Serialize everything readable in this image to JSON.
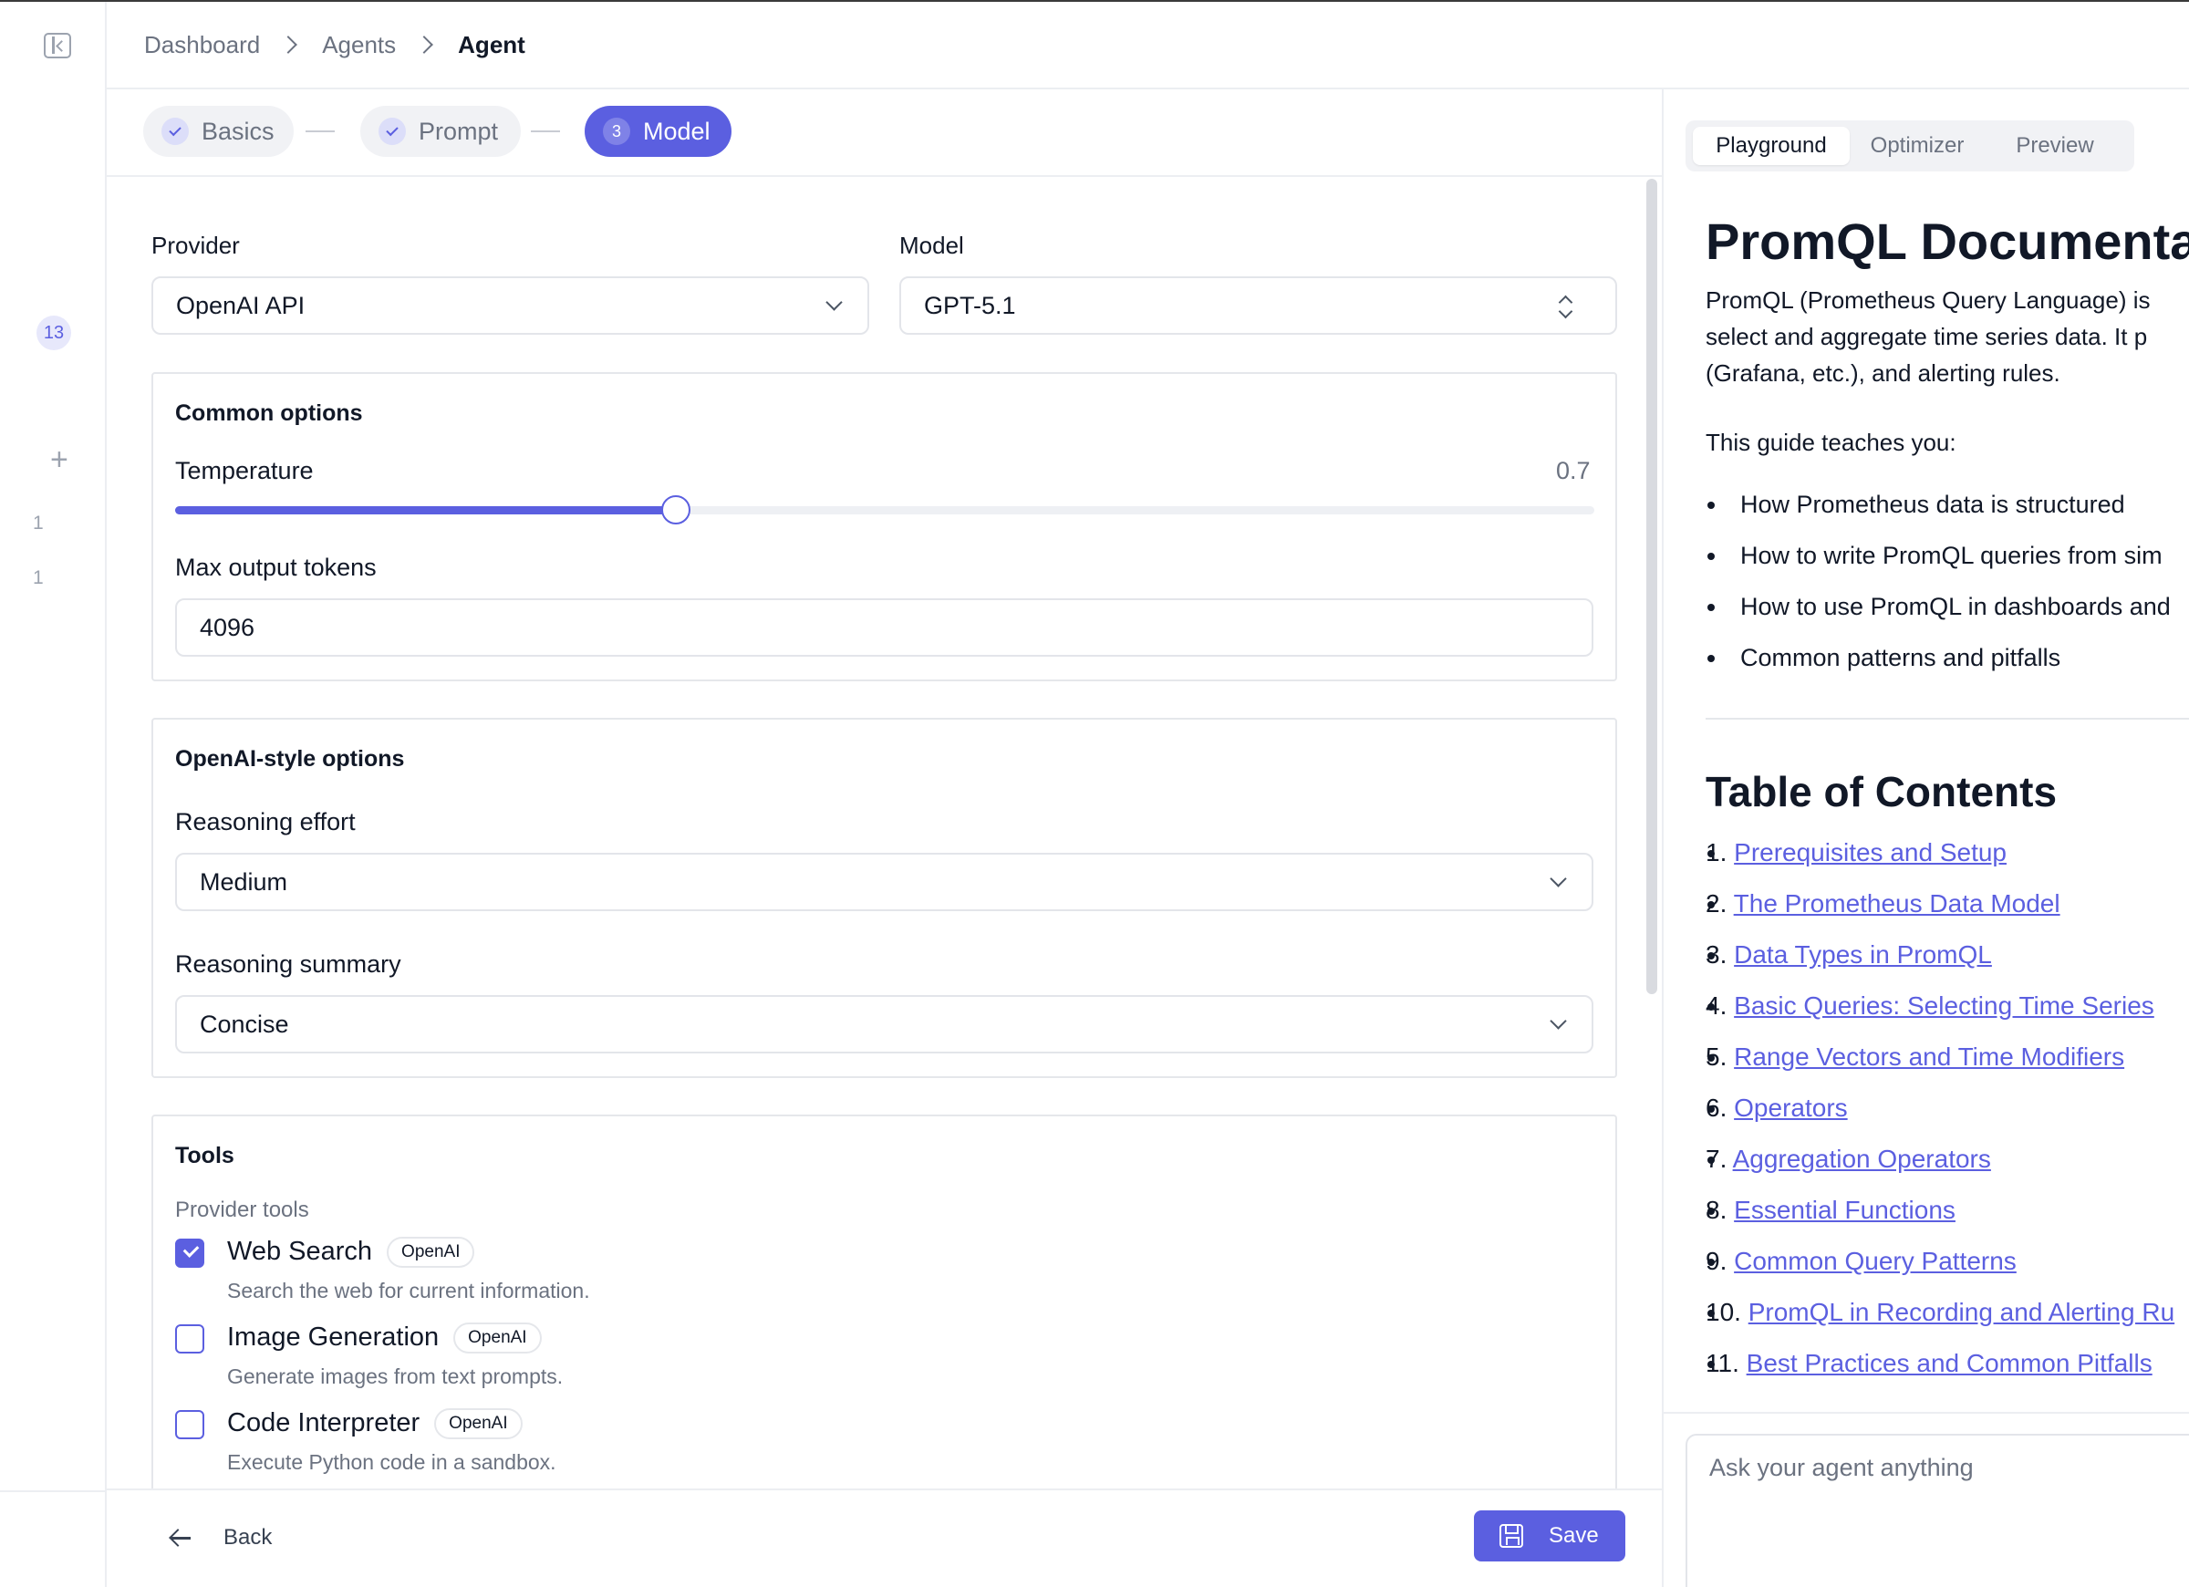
{
  "breadcrumb": {
    "items": [
      "Dashboard",
      "Agents",
      "Agent"
    ]
  },
  "rail": {
    "badge": "13",
    "counts": [
      "1",
      "1"
    ]
  },
  "stepper": {
    "steps": [
      {
        "label": "Basics",
        "state": "done"
      },
      {
        "label": "Prompt",
        "state": "done"
      },
      {
        "label": "Model",
        "state": "current",
        "number": "3"
      }
    ]
  },
  "form": {
    "provider": {
      "label": "Provider",
      "value": "OpenAI API"
    },
    "model": {
      "label": "Model",
      "value": "GPT-5.1"
    },
    "common": {
      "title": "Common options",
      "temperature": {
        "label": "Temperature",
        "value": "0.7",
        "fraction": 0.353
      },
      "max_tokens": {
        "label": "Max output tokens",
        "value": "4096"
      }
    },
    "openai": {
      "title": "OpenAI-style options",
      "reasoning_effort": {
        "label": "Reasoning effort",
        "value": "Medium"
      },
      "reasoning_summary": {
        "label": "Reasoning summary",
        "value": "Concise"
      }
    },
    "tools": {
      "title": "Tools",
      "subtitle": "Provider tools",
      "items": [
        {
          "name": "Web Search",
          "badge": "OpenAI",
          "description": "Search the web for current information.",
          "checked": true
        },
        {
          "name": "Image Generation",
          "badge": "OpenAI",
          "description": "Generate images from text prompts.",
          "checked": false
        },
        {
          "name": "Code Interpreter",
          "badge": "OpenAI",
          "description": "Execute Python code in a sandbox.",
          "checked": false
        }
      ]
    }
  },
  "footer": {
    "back_label": "Back",
    "save_label": "Save"
  },
  "right_panel": {
    "tabs": [
      "Playground",
      "Optimizer",
      "Preview"
    ],
    "active_tab": "Playground",
    "doc": {
      "title": "PromQL Documenta",
      "intro_lines": [
        "PromQL (Prometheus Query Language) is",
        "select and aggregate time series data. It p",
        "(Grafana, etc.), and alerting rules."
      ],
      "guide_intro": "This guide teaches you:",
      "bullets": [
        "How Prometheus data is structured",
        "How to write PromQL queries from sim",
        "How to use PromQL in dashboards and",
        "Common patterns and pitfalls"
      ],
      "toc_title": "Table of Contents",
      "toc": [
        {
          "n": "1.",
          "text": "Prerequisites and Setup"
        },
        {
          "n": "2.",
          "text": "The Prometheus Data Model"
        },
        {
          "n": "3.",
          "text": "Data Types in PromQL"
        },
        {
          "n": "4.",
          "text": "Basic Queries: Selecting Time Series"
        },
        {
          "n": "5.",
          "text": "Range Vectors and Time Modifiers"
        },
        {
          "n": "6.",
          "text": "Operators"
        },
        {
          "n": "7.",
          "text": "Aggregation Operators"
        },
        {
          "n": "8.",
          "text": "Essential Functions"
        },
        {
          "n": "9.",
          "text": "Common Query Patterns"
        },
        {
          "n": "10.",
          "text": "PromQL in Recording and Alerting Ru"
        },
        {
          "n": "11.",
          "text": "Best Practices and Common Pitfalls"
        }
      ]
    },
    "chat": {
      "placeholder": "Ask your agent anything"
    }
  },
  "colors": {
    "accent": "#5b5fe0",
    "border": "#e5e7eb",
    "muted": "#6b7280"
  }
}
